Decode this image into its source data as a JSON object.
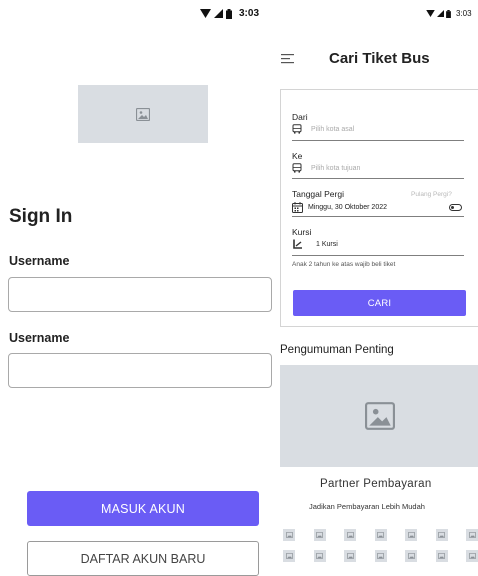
{
  "left_screen": {
    "status_bar": {
      "time": "3:03"
    },
    "title": "Sign In",
    "fields": [
      {
        "label": "Username",
        "value": "",
        "placeholder": ""
      },
      {
        "label": "Username",
        "value": "",
        "placeholder": ""
      }
    ],
    "primary_button": "MASUK AKUN",
    "secondary_button": "DAFTAR AKUN BARU"
  },
  "right_screen": {
    "status_bar": {
      "time": "3:03"
    },
    "header": {
      "title": "Cari Tiket Bus"
    },
    "form": {
      "from": {
        "label": "Dari",
        "placeholder": "Pilih kota asal"
      },
      "to": {
        "label": "Ke",
        "placeholder": "Pilih kota tujuan"
      },
      "date": {
        "label": "Tanggal Pergi",
        "return_link": "Pulang Pergi?",
        "value": "Minggu, 30 Oktober 2022"
      },
      "seats": {
        "label": "Kursi",
        "value": "1 Kursi",
        "note": "Anak 2 tahun ke atas wajib beli tiket"
      },
      "search_button": "CARI"
    },
    "announcement": {
      "title": "Pengumuman Penting"
    },
    "partners": {
      "title": "Partner Pembayaran",
      "subtitle": "Jadikan Pembayaran Lebih Mudah",
      "logo_count": 14
    }
  },
  "icons": {
    "wifi": "wifi-icon",
    "signal": "signal-icon",
    "battery": "battery-icon",
    "image_placeholder": "image-placeholder-icon",
    "menu": "menu-icon",
    "bus": "bus-icon",
    "calendar": "calendar-icon",
    "seat": "seat-icon",
    "toggle": "toggle-icon"
  },
  "colors": {
    "accent": "#6a5cf5",
    "placeholder_bg": "#d9dde2"
  }
}
